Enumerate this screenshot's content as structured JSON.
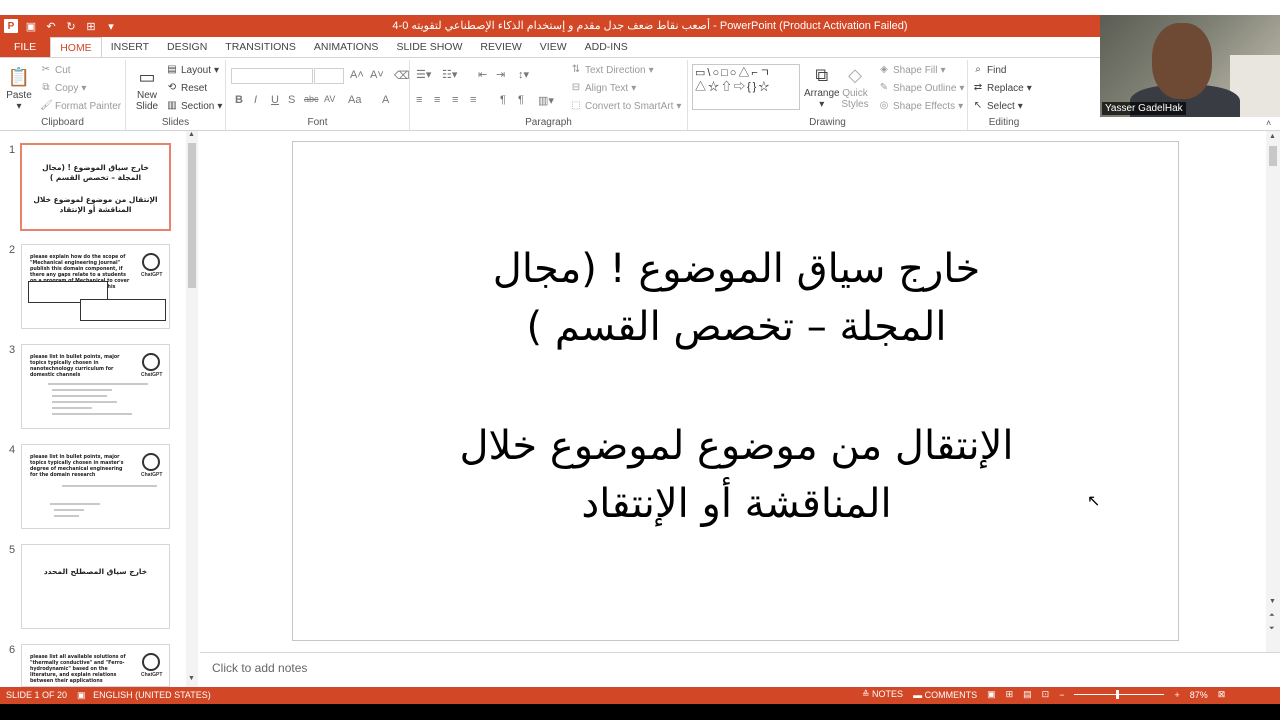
{
  "window": {
    "title": "4-0 أصعب نقاط ضعف جدل مقدم و إستخدام الذكاء الإصطناعي لتقويته -  PowerPoint (Product Activation Failed)"
  },
  "ribbon_tabs": [
    "FILE",
    "HOME",
    "INSERT",
    "DESIGN",
    "TRANSITIONS",
    "ANIMATIONS",
    "SLIDE SHOW",
    "REVIEW",
    "VIEW",
    "ADD-INS"
  ],
  "active_tab": "HOME",
  "clipboard": {
    "paste": "Paste",
    "cut": "Cut",
    "copy": "Copy",
    "format_painter": "Format Painter",
    "label": "Clipboard"
  },
  "slides_group": {
    "new_slide": "New Slide",
    "layout": "Layout",
    "reset": "Reset",
    "section": "Section",
    "label": "Slides"
  },
  "font_group": {
    "label": "Font",
    "bold": "B",
    "italic": "I",
    "underline": "U",
    "shadow": "S",
    "strike": "abc",
    "spacing": "AV",
    "case": "Aa",
    "color": "A"
  },
  "paragraph_group": {
    "text_direction": "Text Direction",
    "align_text": "Align Text",
    "convert_smartart": "Convert to SmartArt",
    "label": "Paragraph"
  },
  "drawing_group": {
    "shapes": "▭\\○□○△⌐ㄱ△☆⇧⇨{}☆",
    "arrange": "Arrange",
    "quick_styles": "Quick Styles",
    "shape_fill": "Shape Fill",
    "shape_outline": "Shape Outline",
    "shape_effects": "Shape Effects",
    "label": "Drawing"
  },
  "editing_group": {
    "find": "Find",
    "replace": "Replace",
    "select": "Select",
    "label": "Editing"
  },
  "webcam": {
    "name": "Yasser GadelHak"
  },
  "thumbnails": [
    {
      "num": "1",
      "lines": [
        "خارج سياق الموضوع ! (مجال",
        "المجلة – تخصص القسم )",
        "",
        "الإنتقال من موضوع لموضوع خلال",
        "المناقشة أو الإنتقاد"
      ]
    },
    {
      "num": "2",
      "text": "please explain how do the scope of \"Mechanical engineering journal\" publish this domain component, if there any gaps relate to a students on a program of Mechanical to cover this section of the scope of this journal?"
    },
    {
      "num": "3",
      "text": "please list in bullet points, major topics typically chosen in nanotechnology curriculum for domestic channels"
    },
    {
      "num": "4",
      "text": "please list in bullet points, major topics typically chosen in master's degree of mechanical engineering for the domain research"
    },
    {
      "num": "5",
      "text": "خارج سياق المصطلح المحدد"
    },
    {
      "num": "6",
      "text": "please list all available solutions of \"thermally conductive\" and \"Ferro-hydrodynamic\" based on the literature, and explain relations between their applications"
    }
  ],
  "gpt_logo_text": "ChatGPT",
  "slide": {
    "title_line1": "خارج سياق الموضوع ! (مجال",
    "title_line2": "المجلة – تخصص القسم )",
    "body_line1": "الإنتقال من موضوع لموضوع خلال",
    "body_line2": "المناقشة أو الإنتقاد"
  },
  "notes_placeholder": "Click to add notes",
  "status": {
    "slide_info": "SLIDE 1 OF 20",
    "language": "ENGLISH (UNITED STATES)",
    "notes": "NOTES",
    "comments": "COMMENTS",
    "zoom": "87%"
  },
  "colors": {
    "accent": "#d24726"
  }
}
